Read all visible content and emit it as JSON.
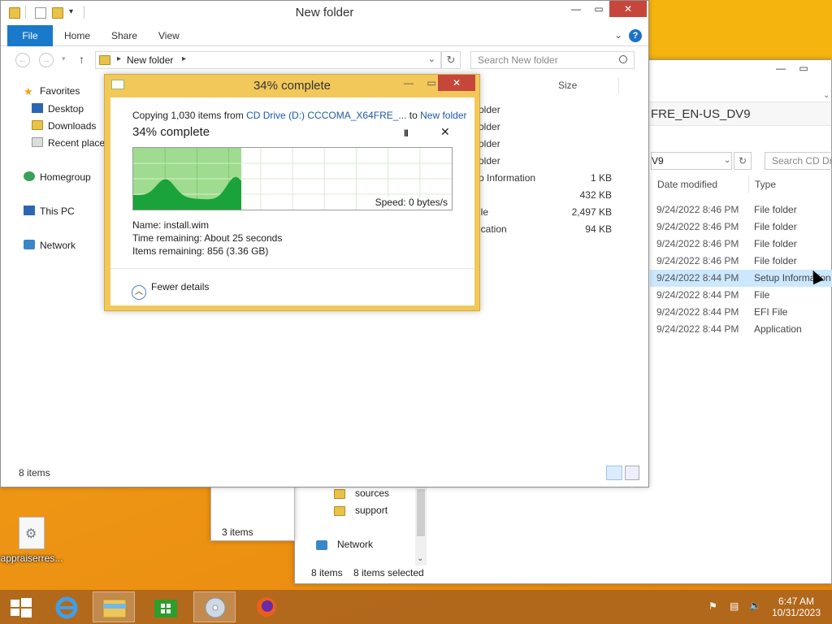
{
  "main_window": {
    "title": "New folder",
    "ribbon_tabs": [
      "File",
      "Home",
      "Share",
      "View"
    ],
    "help_label": "?",
    "address": "New folder",
    "search_placeholder": "Search New folder",
    "nav": {
      "favorites": "Favorites",
      "desktop": "Desktop",
      "downloads": "Downloads",
      "recent": "Recent places",
      "homegroup": "Homegroup",
      "thispc": "This PC",
      "network": "Network"
    },
    "col_size": "Size",
    "rows": [
      {
        "type": "older",
        "size": ""
      },
      {
        "type": "older",
        "size": ""
      },
      {
        "type": "older",
        "size": ""
      },
      {
        "type": "older",
        "size": ""
      },
      {
        "type": "p Information",
        "size": "1 KB"
      },
      {
        "type": "",
        "size": "432 KB"
      },
      {
        "type": "ile",
        "size": "2,497 KB"
      },
      {
        "type": "ication",
        "size": "94 KB"
      }
    ],
    "status": "8 items"
  },
  "copy_dialog": {
    "title": "34% complete",
    "line1_prefix": "Copying 1,030 items from ",
    "line1_source": "CD Drive (D:) CCCOMA_X64FRE_...",
    "line1_mid": " to ",
    "line1_dest": "New folder",
    "heading": "34% complete",
    "percent": 0.34,
    "speed": "Speed: 0 bytes/s",
    "name": "Name:  install.wim",
    "time_remaining": "Time remaining:  About 25 seconds",
    "items_remaining": "Items remaining:  856 (3.36 GB)",
    "fewer_details": "Fewer details",
    "pause_glyph": "II",
    "close_glyph": "✕"
  },
  "cd_window": {
    "path": "FRE_EN-US_DV9",
    "address": "V9",
    "search_placeholder": "Search CD Drive",
    "col_date": "Date modified",
    "col_type": "Type",
    "rows": [
      {
        "date": "9/24/2022 8:46 PM",
        "type": "File folder",
        "selected": false
      },
      {
        "date": "9/24/2022 8:46 PM",
        "type": "File folder",
        "selected": false
      },
      {
        "date": "9/24/2022 8:46 PM",
        "type": "File folder",
        "selected": false
      },
      {
        "date": "9/24/2022 8:46 PM",
        "type": "File folder",
        "selected": false
      },
      {
        "date": "9/24/2022 8:44 PM",
        "type": "Setup Information",
        "selected": true
      },
      {
        "date": "9/24/2022 8:44 PM",
        "type": "File",
        "selected": false
      },
      {
        "date": "9/24/2022 8:44 PM",
        "type": "EFI File",
        "selected": false
      },
      {
        "date": "9/24/2022 8:44 PM",
        "type": "Application",
        "selected": false
      }
    ],
    "sidebar": [
      "sources",
      "support"
    ],
    "sidebar_network": "Network",
    "status_count": "8 items",
    "status_selected": "8 items selected"
  },
  "small_window": {
    "status": "3 items"
  },
  "desktop_icon": {
    "label": "appraiserres..."
  },
  "taskbar": {
    "time": "6:47 AM",
    "date": "10/31/2023"
  },
  "colors": {
    "accent": "#1979ca",
    "dialog_frame": "#f2c85b",
    "close": "#c7463b",
    "graph_fill": "#1aa33a"
  }
}
